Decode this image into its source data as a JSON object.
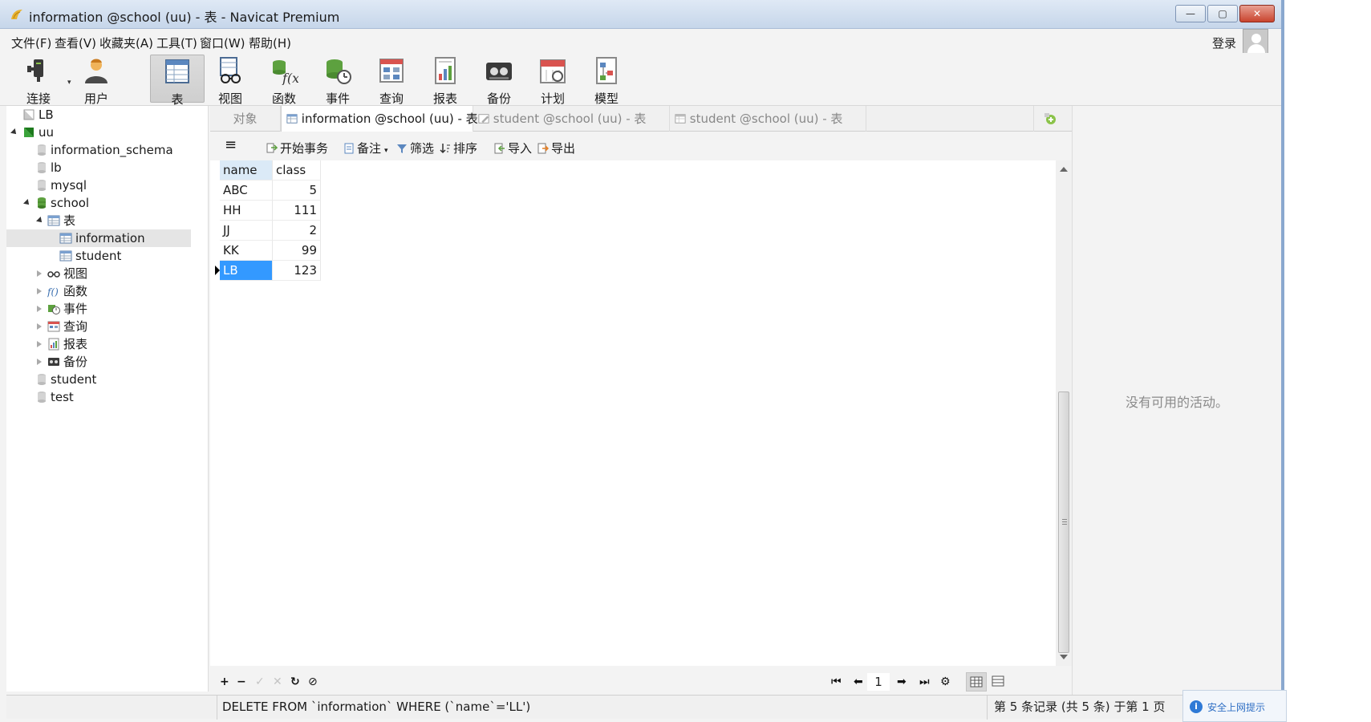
{
  "window": {
    "title": "information @school (uu) - 表 - Navicat Premium",
    "controls": {
      "minimize": "—",
      "maximize": "▢",
      "close": "✕"
    }
  },
  "menu": {
    "items": [
      "文件(F)",
      "查看(V)",
      "收藏夹(A)",
      "工具(T)",
      "窗口(W)",
      "帮助(H)"
    ],
    "login": "登录"
  },
  "toolbar": {
    "items": [
      {
        "label": "连接",
        "icon": "plug-icon"
      },
      {
        "label": "用户",
        "icon": "user-icon"
      },
      {
        "label": "表",
        "icon": "table-icon",
        "active": true
      },
      {
        "label": "视图",
        "icon": "view-glasses-icon"
      },
      {
        "label": "函数",
        "icon": "function-icon"
      },
      {
        "label": "事件",
        "icon": "event-clock-icon"
      },
      {
        "label": "查询",
        "icon": "query-icon"
      },
      {
        "label": "报表",
        "icon": "report-icon"
      },
      {
        "label": "备份",
        "icon": "backup-icon"
      },
      {
        "label": "计划",
        "icon": "calendar-icon"
      },
      {
        "label": "模型",
        "icon": "model-icon"
      }
    ]
  },
  "tree": {
    "items": [
      {
        "label": "LB",
        "icon": "connection-icon"
      },
      {
        "label": "uu",
        "icon": "connection-active-icon",
        "expanded": true
      },
      {
        "label": "information_schema",
        "icon": "database-icon"
      },
      {
        "label": "lb",
        "icon": "database-icon"
      },
      {
        "label": "mysql",
        "icon": "database-icon"
      },
      {
        "label": "school",
        "icon": "database-active-icon",
        "expanded": true
      },
      {
        "label": "表",
        "icon": "table-folder-icon",
        "expanded": true
      },
      {
        "label": "information",
        "icon": "table-icon",
        "selected": true
      },
      {
        "label": "student",
        "icon": "table-icon"
      },
      {
        "label": "视图",
        "icon": "view-glasses-icon"
      },
      {
        "label": "函数",
        "icon": "function-icon"
      },
      {
        "label": "事件",
        "icon": "event-clock-icon"
      },
      {
        "label": "查询",
        "icon": "query-icon"
      },
      {
        "label": "报表",
        "icon": "report-icon"
      },
      {
        "label": "备份",
        "icon": "backup-icon"
      },
      {
        "label": "student",
        "icon": "database-icon"
      },
      {
        "label": "test",
        "icon": "database-icon"
      }
    ]
  },
  "tabs": {
    "objects": "对象",
    "items": [
      {
        "label": "information @school (uu) - 表",
        "active": true
      },
      {
        "label": "student @school (uu) - 表"
      },
      {
        "label": "student @school (uu) - 表"
      }
    ]
  },
  "actions": {
    "menu": "≡",
    "begin_transaction": "开始事务",
    "note": "备注",
    "filter": "筛选",
    "sort": "排序",
    "import": "导入",
    "export": "导出"
  },
  "grid": {
    "columns": [
      "name",
      "class"
    ],
    "rows": [
      [
        "ABC",
        "5"
      ],
      [
        "HH",
        "111"
      ],
      [
        "JJ",
        "2"
      ],
      [
        "KK",
        "99"
      ],
      [
        "LB",
        "123"
      ]
    ],
    "current_row": 4
  },
  "nav": {
    "add": "+",
    "remove": "−",
    "apply": "✓",
    "discard": "✕",
    "refresh": "↻",
    "stop": "⊘",
    "first": "⏮",
    "prev": "⬅",
    "page": "1",
    "next": "➡",
    "last": "⏭",
    "settings": "⚙"
  },
  "status": {
    "sql": "DELETE FROM `information` WHERE (`name`='LL')",
    "records": "第 5 条记录 (共 5 条) 于第 1 页"
  },
  "right_panel": {
    "empty_text": "没有可用的活动。"
  },
  "notification": {
    "icon": "i",
    "text": "安全上网提示"
  }
}
